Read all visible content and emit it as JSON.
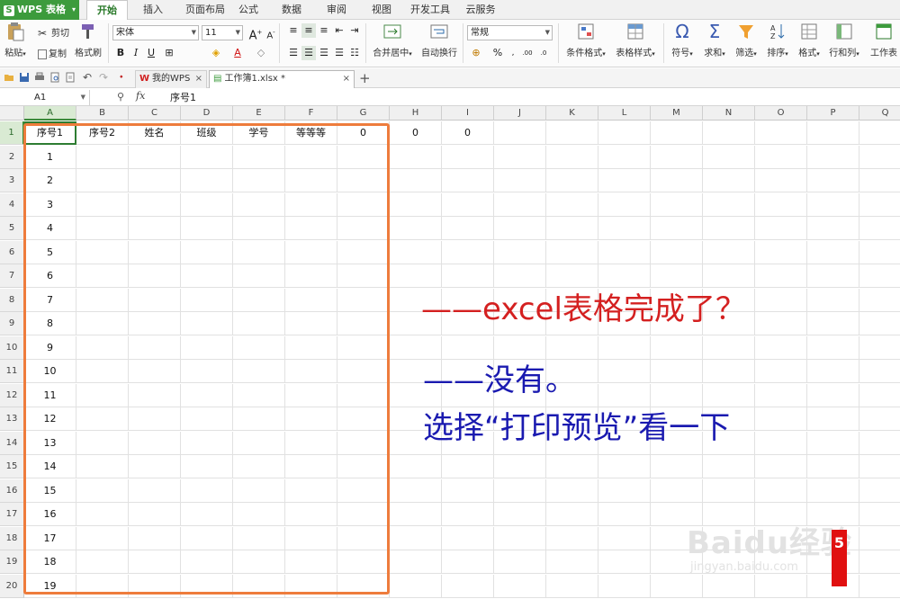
{
  "app": {
    "name": "WPS 表格"
  },
  "menu": [
    "开始",
    "插入",
    "页面布局",
    "公式",
    "数据",
    "审阅",
    "视图",
    "开发工具",
    "云服务"
  ],
  "ribbon": {
    "paste": "粘贴",
    "cut": "剪切",
    "copy": "复制",
    "format_painter": "格式刷",
    "font_name": "宋体",
    "font_size": "11",
    "merge_center": "合并居中",
    "wrap_text": "自动换行",
    "number_format": "常规",
    "conditional_format": "条件格式",
    "table_style": "表格样式",
    "symbol": "符号",
    "sum": "求和",
    "filter": "筛选",
    "sort": "排序",
    "format": "格式",
    "rows_cols": "行和列",
    "worksheet": "工作表"
  },
  "tabs": [
    {
      "label": "我的WPS"
    },
    {
      "label": "工作簿1.xlsx *"
    }
  ],
  "formula_bar": {
    "cell_ref": "A1",
    "fx": "fx",
    "value": "序号1"
  },
  "sheet": {
    "columns": [
      "A",
      "B",
      "C",
      "D",
      "E",
      "F",
      "G",
      "H",
      "I",
      "J",
      "K",
      "L",
      "M",
      "N",
      "O",
      "P",
      "Q"
    ],
    "rows": [
      "1",
      "2",
      "3",
      "4",
      "5",
      "6",
      "7",
      "8",
      "9",
      "10",
      "11",
      "12",
      "13",
      "14",
      "15",
      "16",
      "17",
      "18",
      "19",
      "20"
    ],
    "header_row": [
      "序号1",
      "序号2",
      "姓名",
      "班级",
      "学号",
      "等等等",
      "0",
      "0",
      "0"
    ],
    "col_a_values": [
      "1",
      "2",
      "3",
      "4",
      "5",
      "6",
      "7",
      "8",
      "9",
      "10",
      "11",
      "12",
      "13",
      "14",
      "15",
      "16",
      "17",
      "18",
      "19"
    ],
    "active_cell": "A1"
  },
  "annotations": {
    "line1": "——excel表格完成了？",
    "line2": "——没有。",
    "line3": "选择“打印预览”看一下"
  },
  "watermark": {
    "main": "Baidu经验",
    "sub": "jingyan.baidu.com"
  },
  "step_badge": "5",
  "colors": {
    "accent_green": "#3c9b3c",
    "highlight_orange": "#ee7c3c",
    "annotation_red": "#d42020",
    "annotation_blue": "#1a1ab0"
  }
}
